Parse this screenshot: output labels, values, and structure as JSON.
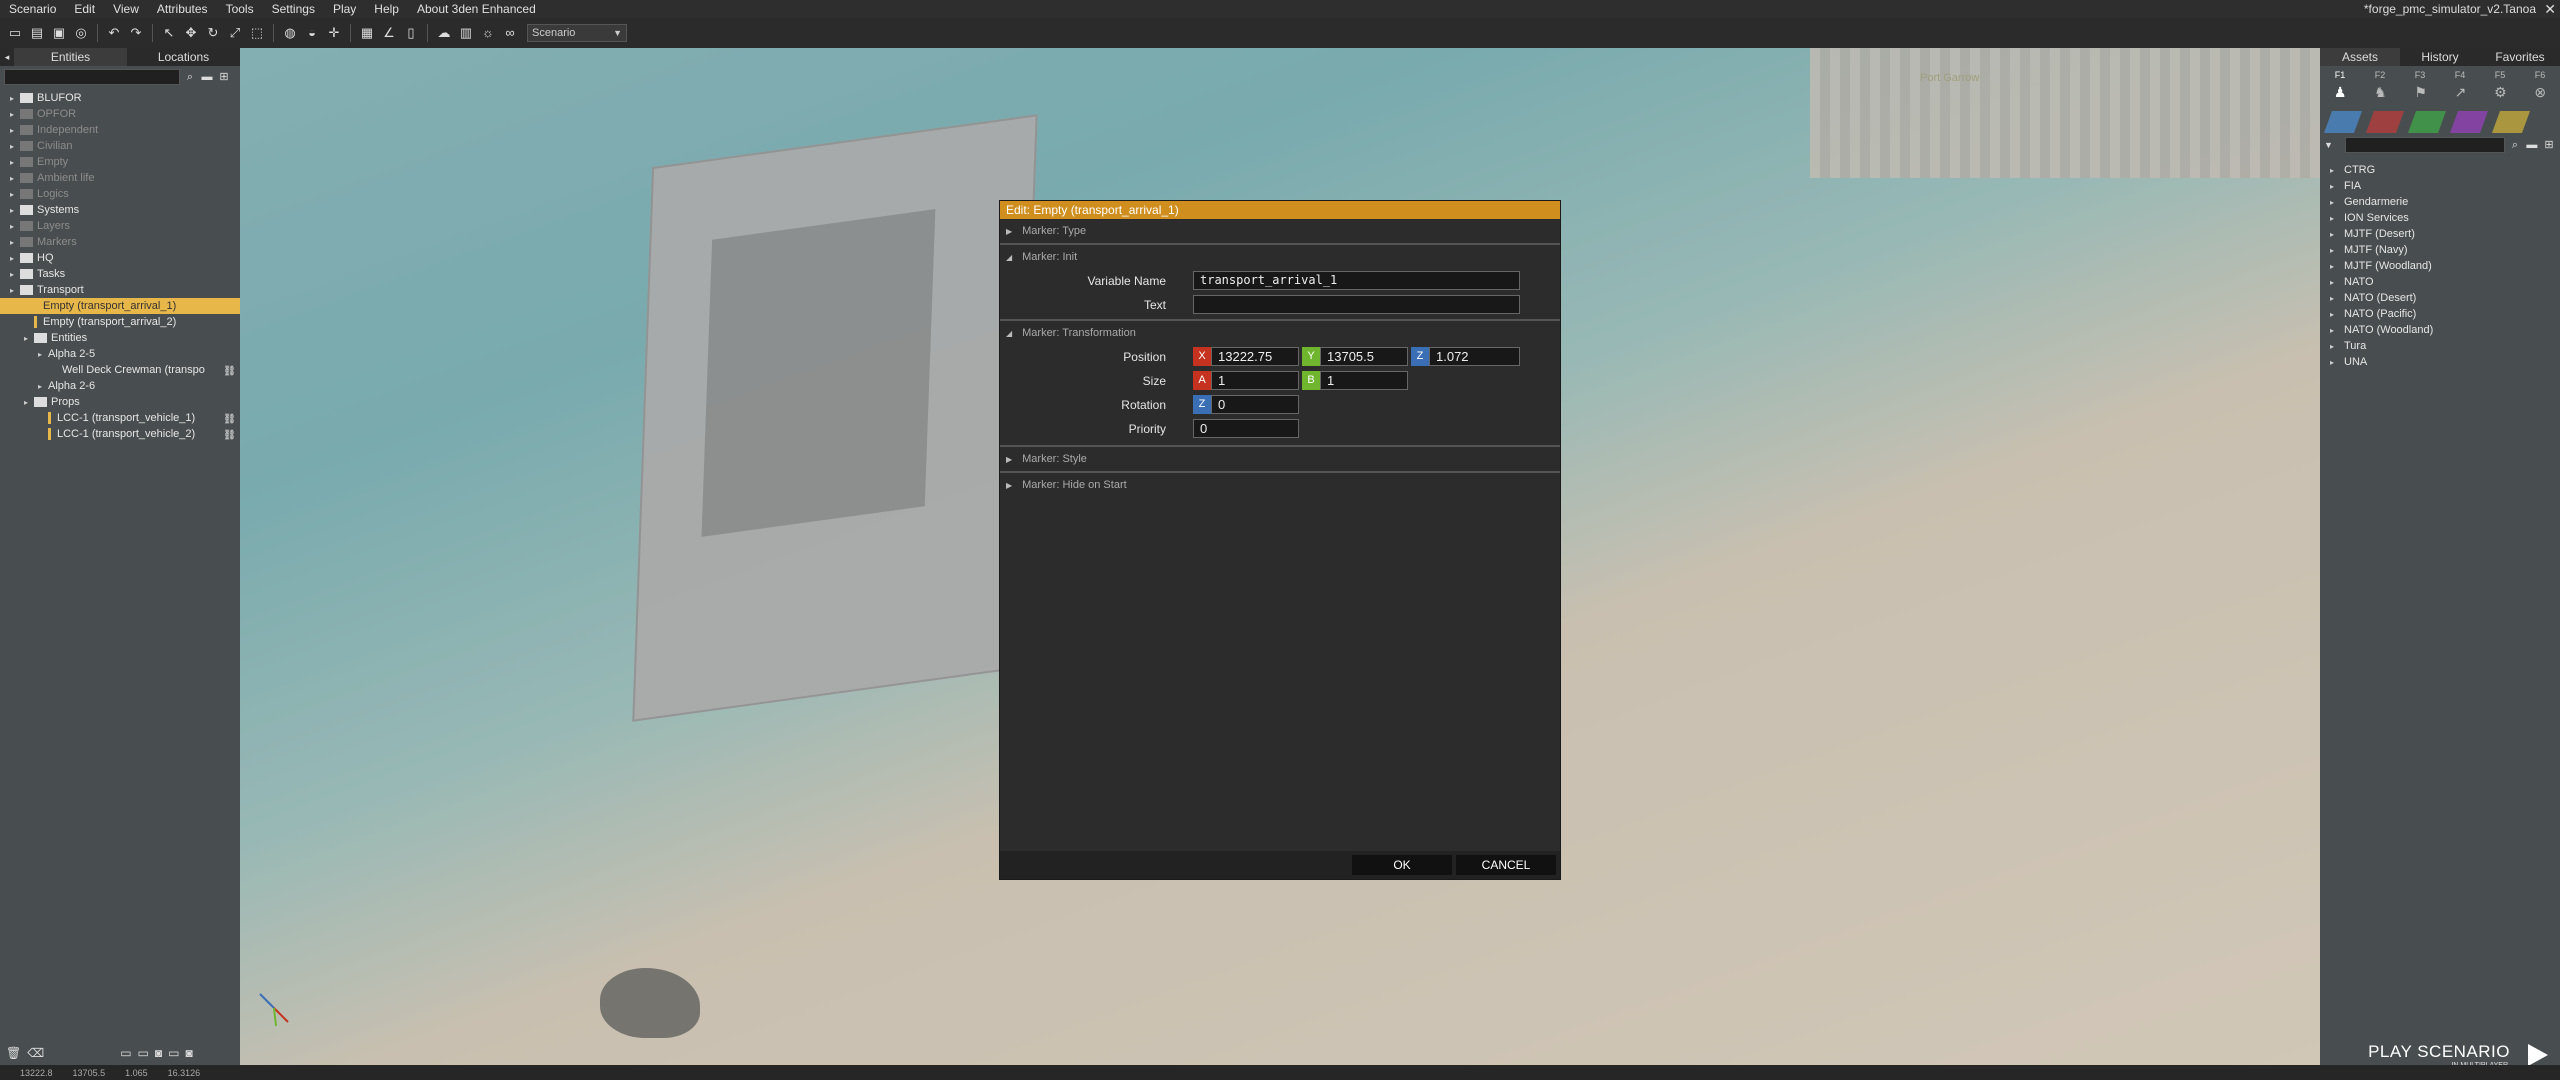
{
  "menubar": {
    "items": [
      "Scenario",
      "Edit",
      "View",
      "Attributes",
      "Tools",
      "Settings",
      "Play",
      "Help",
      "About 3den Enhanced"
    ],
    "mission_title": "*forge_pmc_simulator_v2.Tanoa"
  },
  "toolbar": {
    "scenario_select": "Scenario"
  },
  "left_panel": {
    "tabs": [
      "Entities",
      "Locations"
    ],
    "tree": [
      {
        "label": "BLUFOR",
        "level": 0,
        "type": "folder",
        "dim": false
      },
      {
        "label": "OPFOR",
        "level": 0,
        "type": "folder",
        "dim": true
      },
      {
        "label": "Independent",
        "level": 0,
        "type": "folder",
        "dim": true
      },
      {
        "label": "Civilian",
        "level": 0,
        "type": "folder",
        "dim": true
      },
      {
        "label": "Empty",
        "level": 0,
        "type": "folder",
        "dim": true
      },
      {
        "label": "Ambient life",
        "level": 0,
        "type": "folder",
        "dim": true
      },
      {
        "label": "Logics",
        "level": 0,
        "type": "folder",
        "dim": true
      },
      {
        "label": "Systems",
        "level": 0,
        "type": "folder",
        "dim": false
      },
      {
        "label": "Layers",
        "level": 0,
        "type": "folder",
        "dim": true
      },
      {
        "label": "Markers",
        "level": 0,
        "type": "folder",
        "dim": true
      },
      {
        "label": "HQ",
        "level": 0,
        "type": "folder",
        "dim": false
      },
      {
        "label": "Tasks",
        "level": 0,
        "type": "folder",
        "dim": false
      },
      {
        "label": "Transport",
        "level": 0,
        "type": "folder",
        "dim": false
      },
      {
        "label": "Empty (transport_arrival_1)",
        "level": 1,
        "type": "marker",
        "selected": true
      },
      {
        "label": "Empty (transport_arrival_2)",
        "level": 1,
        "type": "marker"
      },
      {
        "label": "Entities",
        "level": 1,
        "type": "folder"
      },
      {
        "label": "Alpha 2-5",
        "level": 2,
        "type": "group"
      },
      {
        "label": "Well Deck Crewman (transpo",
        "level": 3,
        "type": "unit",
        "link": true
      },
      {
        "label": "Alpha 2-6",
        "level": 2,
        "type": "group"
      },
      {
        "label": "Props",
        "level": 1,
        "type": "folder"
      },
      {
        "label": "LCC-1 (transport_vehicle_1)",
        "level": 2,
        "type": "prop",
        "link": true
      },
      {
        "label": "LCC-1 (transport_vehicle_2)",
        "level": 2,
        "type": "prop",
        "link": true
      }
    ]
  },
  "right_panel": {
    "tabs": [
      "Assets",
      "History",
      "Favorites"
    ],
    "fkeys": [
      "F1",
      "F2",
      "F3",
      "F4",
      "F5",
      "F6"
    ],
    "swatch_colors": [
      "#4a8fd8",
      "#c43b3b",
      "#3fae4a",
      "#9b3fc4",
      "#d6b53a"
    ],
    "factions": [
      "CTRG",
      "FIA",
      "Gendarmerie",
      "ION Services",
      "MJTF (Desert)",
      "MJTF (Navy)",
      "MJTF (Woodland)",
      "NATO",
      "NATO (Desert)",
      "NATO (Pacific)",
      "NATO (Woodland)",
      "Tura",
      "UNA"
    ]
  },
  "scene": {
    "pier_label": "Port Garrow"
  },
  "play": {
    "label": "PLAY SCENARIO",
    "sub": "IN MULTIPLAYER"
  },
  "status": {
    "x": "13222.8",
    "y": "13705.5",
    "z": "1.065",
    "fov": "16.3126"
  },
  "dialog": {
    "title": "Edit: Empty (transport_arrival_1)",
    "sections": {
      "type": "Marker: Type",
      "init": "Marker: Init",
      "transform": "Marker: Transformation",
      "style": "Marker: Style",
      "hide": "Marker: Hide on Start"
    },
    "fields": {
      "variable_name_label": "Variable Name",
      "variable_name": "transport_arrival_1",
      "text_label": "Text",
      "text": "",
      "position_label": "Position",
      "pos_x": "13222.75",
      "pos_y": "13705.5",
      "pos_z": "1.072",
      "size_label": "Size",
      "size_a": "1",
      "size_b": "1",
      "rotation_label": "Rotation",
      "rotation": "0",
      "priority_label": "Priority",
      "priority": "0"
    },
    "axis_tags": {
      "x": "X",
      "y": "Y",
      "z": "Z",
      "a": "A",
      "b": "B"
    },
    "ok_label": "OK",
    "cancel_label": "CANCEL"
  }
}
